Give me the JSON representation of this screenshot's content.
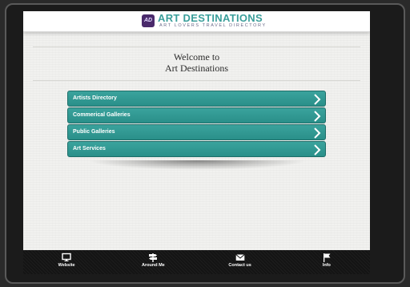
{
  "header": {
    "logo_text": "AD",
    "title": "ART DESTINATIONS",
    "tagline": "ART LOVERS TRAVEL DIRECTORY"
  },
  "welcome": {
    "line1": "Welcome to",
    "line2": "Art Destinations"
  },
  "menu": {
    "items": [
      {
        "label": "Artists Directory"
      },
      {
        "label": "Commerical Galleries"
      },
      {
        "label": "Public Galleries"
      },
      {
        "label": "Art Services"
      }
    ]
  },
  "bottom_nav": {
    "items": [
      {
        "label": "Website",
        "icon": "monitor-icon"
      },
      {
        "label": "Around Me",
        "icon": "signpost-icon"
      },
      {
        "label": "Contact us",
        "icon": "envelope-icon"
      },
      {
        "label": "Info",
        "icon": "flag-icon"
      }
    ]
  },
  "colors": {
    "accent": "#2f9690",
    "title": "#3a9e9a",
    "bar": "#141414"
  }
}
